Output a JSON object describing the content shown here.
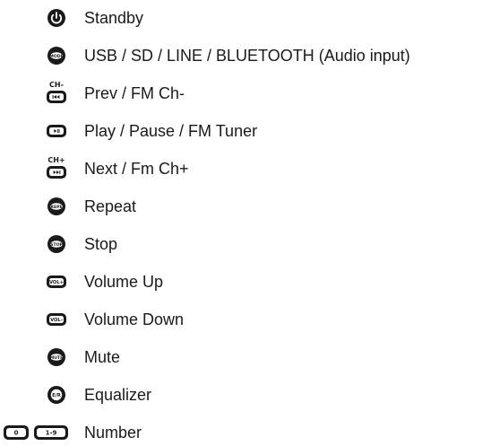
{
  "legend": {
    "items": [
      {
        "id": "standby",
        "label": "Standby",
        "icon": "power-icon"
      },
      {
        "id": "mode",
        "label": "USB / SD / LINE / BLUETOOTH (Audio input)",
        "icon": "mode-button-icon",
        "icon_text": "MODE"
      },
      {
        "id": "prev",
        "label": "Prev / FM Ch-",
        "icon": "prev-ch-minus-icon",
        "icon_text": "CH-"
      },
      {
        "id": "play",
        "label": "Play / Pause / FM Tuner",
        "icon": "play-pause-icon"
      },
      {
        "id": "next",
        "label": "Next / Fm Ch+",
        "icon": "next-ch-plus-icon",
        "icon_text": "CH+"
      },
      {
        "id": "repeat",
        "label": "Repeat",
        "icon": "repeat-button-icon",
        "icon_text": "REPE"
      },
      {
        "id": "stop",
        "label": "Stop",
        "icon": "stop-button-icon",
        "icon_text": "STOP"
      },
      {
        "id": "vol-up",
        "label": "Volume Up",
        "icon": "volume-up-icon",
        "icon_text": "VOL+"
      },
      {
        "id": "vol-down",
        "label": "Volume Down",
        "icon": "volume-down-icon",
        "icon_text": "VOL-"
      },
      {
        "id": "mute",
        "label": "Mute",
        "icon": "mute-button-icon",
        "icon_text": "MUTE"
      },
      {
        "id": "equalizer",
        "label": "Equalizer",
        "icon": "equalizer-button-icon",
        "icon_text": "E/R"
      },
      {
        "id": "number",
        "label": "Number",
        "icon": "number-buttons-icon",
        "icon_text_a": "0",
        "icon_text_b": "1-9"
      }
    ]
  }
}
